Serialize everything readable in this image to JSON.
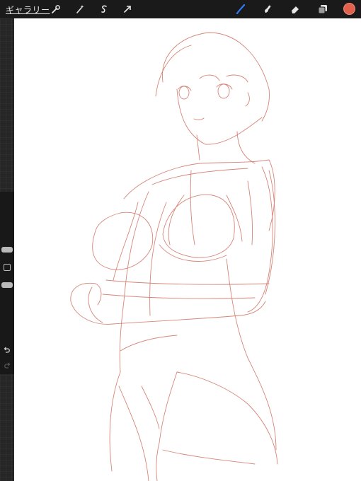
{
  "toolbar": {
    "gallery_label": "ギャラリー",
    "left_tools": [
      "wrench-icon",
      "magic-wand-icon",
      "selection-icon",
      "transform-arrow-icon"
    ],
    "right_tools": [
      "brush-icon",
      "smudge-icon",
      "eraser-icon",
      "layers-icon"
    ],
    "active_tool": "brush",
    "accent_color": "#2f7cf6",
    "current_color": "#e2614c"
  },
  "sidebar": {
    "controls": [
      "brush-size-slider",
      "modify-button",
      "opacity-slider",
      "undo-button",
      "redo-button"
    ]
  },
  "canvas": {
    "background": "#ffffff",
    "sketch_color": "#d2786a"
  }
}
